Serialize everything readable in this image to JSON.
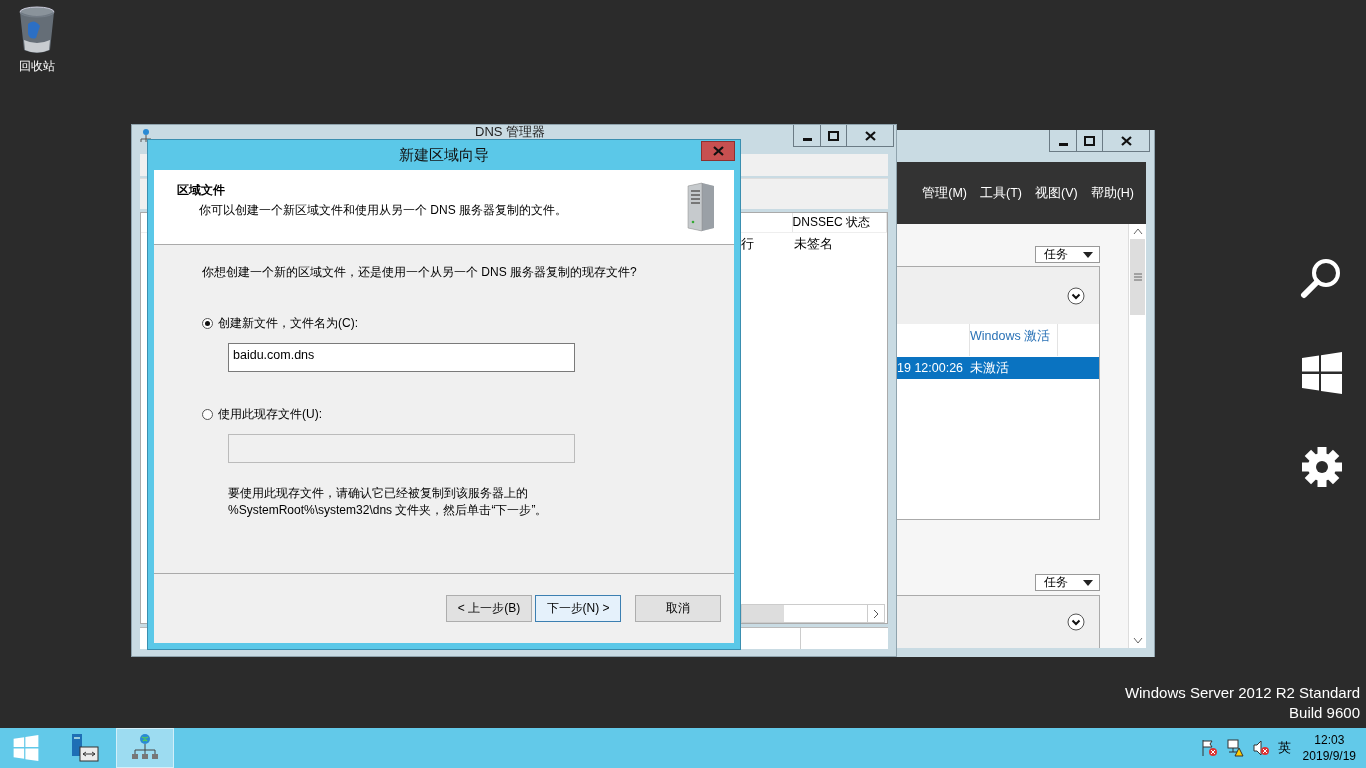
{
  "desktop": {
    "icons": [
      {
        "label": "回收站"
      }
    ],
    "edition": "Windows Server 2012 R2 Standard",
    "build": "Build 9600"
  },
  "server_manager": {
    "menu": [
      "管理(M)",
      "工具(T)",
      "视图(V)",
      "帮助(H)"
    ],
    "task_buttons": [
      "任务",
      "任务"
    ],
    "table": {
      "columns": [
        "",
        "Windows 激活"
      ],
      "rows": [
        {
          "cells": [
            "19 12:00:26",
            "未激活"
          ],
          "selected": true
        }
      ]
    }
  },
  "dns_manager": {
    "title": "DNS 管理器",
    "columns": [
      "",
      "DNSSEC 状态"
    ],
    "rows": [
      {
        "cells": [
          "行",
          "未签名"
        ]
      }
    ]
  },
  "wizard": {
    "title": "新建区域向导",
    "heading": "区域文件",
    "subheading": "你可以创建一个新区域文件和使用从另一个 DNS 服务器复制的文件。",
    "question": "你想创建一个新的区域文件，还是使用一个从另一个 DNS 服务器复制的现存文件?",
    "options": [
      {
        "label": "创建新文件，文件名为(C):",
        "selected": true,
        "value": "baidu.com.dns"
      },
      {
        "label": "使用此现存文件(U):",
        "selected": false
      }
    ],
    "note": "要使用此现存文件，请确认它已经被复制到该服务器上的\n%SystemRoot%\\system32\\dns 文件夹，然后单击“下一步”。",
    "buttons": [
      {
        "label": "< 上一步(B)",
        "focused": false
      },
      {
        "label": "下一步(N) >",
        "focused": true
      },
      {
        "label": "取消",
        "focused": false
      }
    ]
  },
  "taskbar": {
    "apps": [
      {
        "kind": "server-manager",
        "selected": false
      },
      {
        "kind": "dns",
        "selected": true
      }
    ],
    "language": "英",
    "time": "12:03",
    "date": "2019/9/19"
  }
}
